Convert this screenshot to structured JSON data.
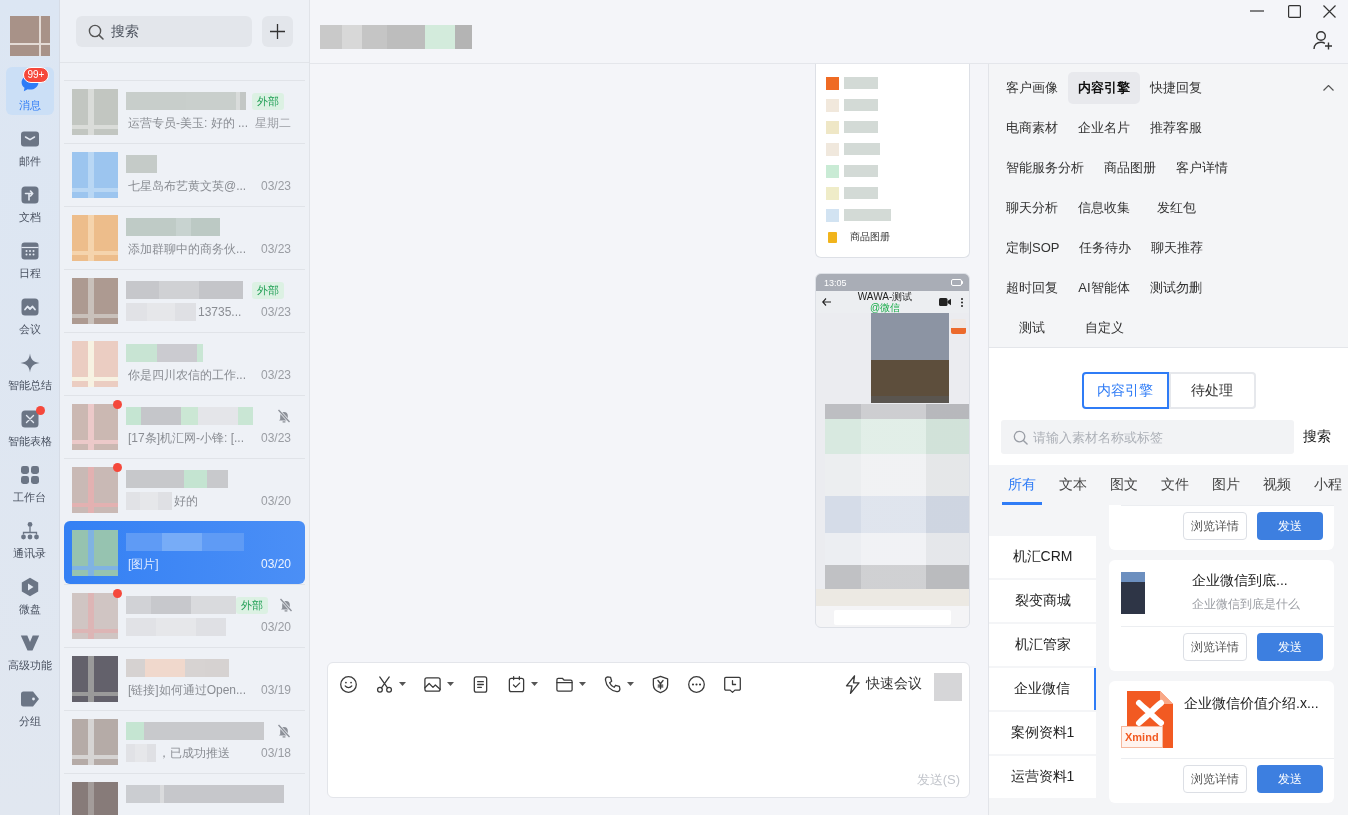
{
  "nav": {
    "items": [
      {
        "label": "消息",
        "selected": true,
        "badge": "99+",
        "dot": false
      },
      {
        "label": "邮件",
        "selected": false,
        "dot": false
      },
      {
        "label": "文档",
        "selected": false,
        "dot": false
      },
      {
        "label": "日程",
        "selected": false,
        "dot": false
      },
      {
        "label": "会议",
        "selected": false,
        "dot": false
      },
      {
        "label": "智能总结",
        "selected": false,
        "dot": false
      },
      {
        "label": "智能表格",
        "selected": false,
        "dot": true
      },
      {
        "label": "工作台",
        "selected": false,
        "dot": false
      },
      {
        "label": "通讯录",
        "selected": false,
        "dot": false
      },
      {
        "label": "微盘",
        "selected": false,
        "dot": false
      },
      {
        "label": "高级功能",
        "selected": false,
        "dot": false
      },
      {
        "label": "分组",
        "selected": false,
        "dot": false
      }
    ]
  },
  "chats": {
    "search": {
      "placeholder": "搜索"
    },
    "items": [
      {
        "tag": "外部",
        "preview": "运营专员-美玉: 好的 ...",
        "time": "星期二",
        "selected": false,
        "muted": false,
        "unread": false,
        "masked": false
      },
      {
        "preview": "七星岛布艺黄文英@...",
        "time": "03/23",
        "selected": false,
        "muted": false,
        "unread": false,
        "masked": false
      },
      {
        "preview": "添加群聊中的商务伙...",
        "time": "03/23",
        "selected": false,
        "muted": false,
        "unread": false,
        "masked": false
      },
      {
        "tag": "外部",
        "preview": "13735...",
        "time": "03/23",
        "selected": false,
        "muted": false,
        "unread": false,
        "masked": true
      },
      {
        "preview": "你是四川农信的工作...",
        "time": "03/23",
        "selected": false,
        "muted": false,
        "unread": false,
        "masked": false
      },
      {
        "preview": "[17条]机汇网-小锋: [...",
        "time": "03/23",
        "selected": false,
        "muted": true,
        "unread": true,
        "masked": false
      },
      {
        "preview": "好的",
        "time": "03/20",
        "selected": false,
        "muted": false,
        "unread": true,
        "masked": true
      },
      {
        "preview": "[图片]",
        "time": "03/20",
        "selected": true,
        "muted": false,
        "unread": false,
        "masked": false
      },
      {
        "tag": "外部",
        "time": "03/20",
        "selected": false,
        "muted": true,
        "unread": true,
        "masked": true
      },
      {
        "preview": "[链接]如何通过Open...",
        "time": "03/19",
        "selected": false,
        "muted": false,
        "unread": false,
        "masked": false
      },
      {
        "preview": "，已成功推送",
        "time": "03/18",
        "selected": false,
        "muted": true,
        "unread": false,
        "masked": true
      },
      {
        "selected": false,
        "muted": false,
        "unread": false,
        "masked": false
      }
    ]
  },
  "conversation": {
    "messages": [
      {
        "kind": "list",
        "label": "商品图册"
      },
      {
        "kind": "phone",
        "status_time": "13:05",
        "title": "WAWA-测试",
        "subtitle": "@微信"
      }
    ],
    "composer": {
      "quick_meeting": "快速会议",
      "send_button": {
        "label": "发送(S)",
        "disabled": true
      }
    }
  },
  "panel": {
    "tools": [
      {
        "label": "客户画像",
        "selected": false
      },
      {
        "label": "内容引擎",
        "selected": true
      },
      {
        "label": "快捷回复",
        "selected": false
      },
      {
        "label": "电商素材",
        "selected": false
      },
      {
        "label": "企业名片",
        "selected": false
      },
      {
        "label": "推荐客服",
        "selected": false
      },
      {
        "label": "智能服务分析",
        "selected": false
      },
      {
        "label": "商品图册",
        "selected": false
      },
      {
        "label": "客户详情",
        "selected": false
      },
      {
        "label": "聊天分析",
        "selected": false
      },
      {
        "label": "信息收集",
        "selected": false
      },
      {
        "label": "发红包",
        "selected": false
      },
      {
        "label": "定制SOP",
        "selected": false
      },
      {
        "label": "任务待办",
        "selected": false
      },
      {
        "label": "聊天推荐",
        "selected": false
      },
      {
        "label": "超时回复",
        "selected": false
      },
      {
        "label": "AI智能体",
        "selected": false
      },
      {
        "label": "测试勿删",
        "selected": false
      },
      {
        "label": "测试",
        "selected": false
      },
      {
        "label": "自定义",
        "selected": false
      }
    ],
    "segments": [
      {
        "label": "内容引擎",
        "selected": true
      },
      {
        "label": "待处理",
        "selected": false
      }
    ],
    "search": {
      "placeholder": "请输入素材名称或标签",
      "button": "搜索"
    },
    "types": [
      {
        "label": "所有",
        "selected": true
      },
      {
        "label": "文本",
        "selected": false
      },
      {
        "label": "图文",
        "selected": false
      },
      {
        "label": "文件",
        "selected": false
      },
      {
        "label": "图片",
        "selected": false
      },
      {
        "label": "视频",
        "selected": false
      },
      {
        "label": "小程",
        "selected": false
      }
    ],
    "categories": [
      {
        "label": "机汇CRM",
        "selected": false
      },
      {
        "label": "裂变商城",
        "selected": false
      },
      {
        "label": "机汇管家",
        "selected": false
      },
      {
        "label": "企业微信",
        "selected": true
      },
      {
        "label": "案例资料1",
        "selected": false
      },
      {
        "label": "运营资料1",
        "selected": false
      }
    ],
    "materials": [
      {
        "kind": "partial",
        "detail_button": "浏览详情",
        "send_button": "发送"
      },
      {
        "kind": "article",
        "title": "企业微信到底...",
        "summary": "企业微信到底是什么",
        "detail_button": "浏览详情",
        "send_button": "发送"
      },
      {
        "kind": "file",
        "title": "企业微信价值介绍.x...",
        "file_label": "Xmind",
        "detail_button": "浏览详情",
        "send_button": "发送"
      }
    ]
  }
}
